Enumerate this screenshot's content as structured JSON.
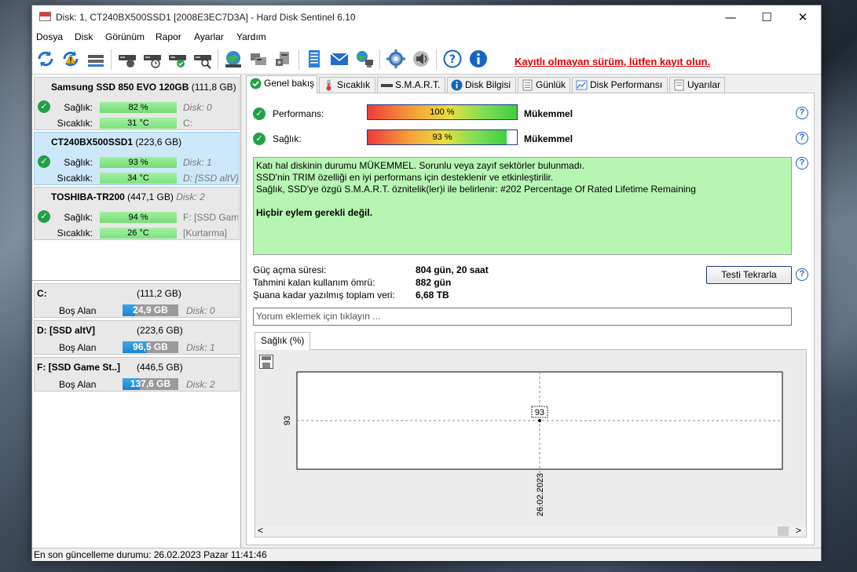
{
  "window": {
    "title": "Disk: 1, CT240BX500SSD1 [2008E3EC7D3A]  -  Hard Disk Sentinel 6.10"
  },
  "menu": [
    "Dosya",
    "Disk",
    "Görünüm",
    "Rapor",
    "Ayarlar",
    "Yardım"
  ],
  "toolbar": {
    "icons": [
      "refresh-icon",
      "refresh-warning-icon",
      "disk-list-icon",
      "disk-status-icon",
      "disk-schedule-icon",
      "disk-check-icon",
      "disk-search-icon",
      "globe-icon",
      "devices-icon",
      "device-settings-icon",
      "report-icon",
      "email-icon",
      "network-icon",
      "settings-icon",
      "sound-icon",
      "help-icon",
      "info-icon"
    ],
    "registration_text": "Kayıtlı olmayan sürüm, lütfen kayıt olun."
  },
  "disks": [
    {
      "name": "Samsung SSD 850 EVO 120GB",
      "size": "(111,8 GB)",
      "health_label": "Sağlık:",
      "health": "82 %",
      "health_pct": 82,
      "temp_label": "Sıcaklık:",
      "temp": "31 °C",
      "right1": "Disk: 0",
      "right2": "C:",
      "selected": false
    },
    {
      "name": "CT240BX500SSD1",
      "size": "(223,6 GB)",
      "health_label": "Sağlık:",
      "health": "93 %",
      "health_pct": 93,
      "temp_label": "Sıcaklık:",
      "temp": "34 °C",
      "right1": "Disk: 1",
      "right2": "D: [SSD altV]",
      "selected": true
    },
    {
      "name": "TOSHIBA-TR200",
      "size": "(447,1 GB)",
      "extra": "Disk: 2",
      "health_label": "Sağlık:",
      "health": "94 %",
      "health_pct": 94,
      "temp_label": "Sıcaklık:",
      "temp": "26 °C",
      "right1": "F: [SSD Game",
      "right2": "[Kurtarma]",
      "selected": false
    }
  ],
  "partitions": [
    {
      "name": "C:",
      "size": "(111,2 GB)",
      "free_label": "Boş Alan",
      "free": "24,9 GB",
      "free_pct": 22,
      "disk": "Disk: 0"
    },
    {
      "name": "D: [SSD altV]",
      "size": "(223,6 GB)",
      "free_label": "Boş Alan",
      "free": "96,5 GB",
      "free_pct": 43,
      "disk": "Disk: 1"
    },
    {
      "name": "F: [SSD Game St..]",
      "size": "(446,5 GB)",
      "free_label": "Boş Alan",
      "free": "137,6 GB",
      "free_pct": 31,
      "disk": "Disk: 2"
    }
  ],
  "status_bar": "En son güncelleme durumu: 26.02.2023 Pazar 11:41:46",
  "tabs": [
    "Genel bakış",
    "Sıcaklık",
    "S.M.A.R.T.",
    "Disk Bilgisi",
    "Günlük",
    "Disk Performansı",
    "Uyarılar"
  ],
  "overview": {
    "performance_label": "Performans:",
    "performance": "100 %",
    "performance_pct": 100,
    "performance_rating": "Mükemmel",
    "health_label": "Sağlık:",
    "health": "93 %",
    "health_pct": 93,
    "health_rating": "Mükemmel",
    "info_lines": [
      "Katı hal diskinin durumu MÜKEMMEL. Sorunlu veya zayıf sektörler bulunmadı.",
      "SSD'nin TRIM özelliği en iyi performans için desteklenir ve etkinleştirilir.",
      "Sağlık, SSD'ye özgü S.M.A.R.T. öznitelik(ler)i ile belirlenir:  #202 Percentage Of Rated Lifetime Remaining"
    ],
    "info_action": "Hiçbir eylem gerekli değil.",
    "power_on_label": "Güç açma süresi:",
    "power_on": "804 gün, 20 saat",
    "remaining_label": "Tahmini kalan kullanım ömrü:",
    "remaining": "882 gün",
    "written_label": "Şuana kadar yazılmış toplam veri:",
    "written": "6,68 TB",
    "retest_button": "Testi Tekrarla",
    "comment_placeholder": "Yorum eklemek için tıklayın ...",
    "chart_tab": "Sağlık (%)"
  },
  "chart_data": {
    "type": "line",
    "title": "",
    "xlabel": "",
    "ylabel": "",
    "x": [
      "26.02.2023"
    ],
    "series": [
      {
        "values": [
          93
        ]
      }
    ],
    "y_tick_labels": [
      "93"
    ],
    "x_tick_labels": [
      "26.02.2023"
    ],
    "data_labels": [
      "93"
    ],
    "grid": true,
    "gridline_style": "dashed"
  }
}
